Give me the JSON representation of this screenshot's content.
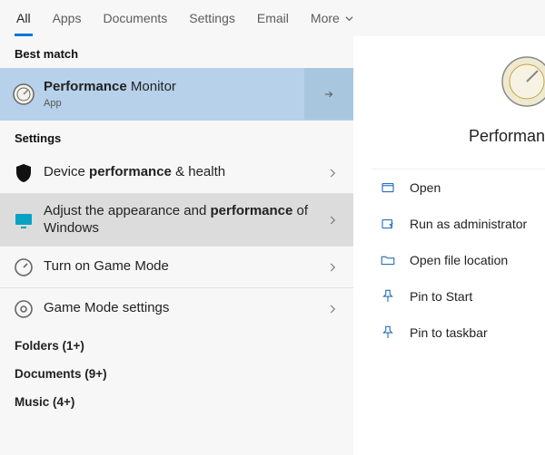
{
  "tabs": {
    "items": [
      {
        "label": "All"
      },
      {
        "label": "Apps"
      },
      {
        "label": "Documents"
      },
      {
        "label": "Settings"
      },
      {
        "label": "Email"
      },
      {
        "label": "More"
      }
    ]
  },
  "left": {
    "best_match_label": "Best match",
    "best_match": {
      "title_strong": "Performance",
      "title_rest": " Monitor",
      "subtitle": "App"
    },
    "settings_label": "Settings",
    "settings_items": [
      {
        "pre": "Device ",
        "strong": "performance",
        "post": " & health"
      },
      {
        "pre": "Adjust the appearance and ",
        "strong": "performance",
        "post": " of Windows"
      },
      {
        "pre": "Turn on Game Mode",
        "strong": "",
        "post": ""
      },
      {
        "pre": "Game Mode settings",
        "strong": "",
        "post": ""
      }
    ],
    "extra": [
      {
        "label": "Folders (1+)"
      },
      {
        "label": "Documents (9+)"
      },
      {
        "label": "Music (4+)"
      }
    ]
  },
  "right": {
    "title": "Performan",
    "actions": [
      {
        "label": "Open"
      },
      {
        "label": "Run as administrator"
      },
      {
        "label": "Open file location"
      },
      {
        "label": "Pin to Start"
      },
      {
        "label": "Pin to taskbar"
      }
    ]
  }
}
